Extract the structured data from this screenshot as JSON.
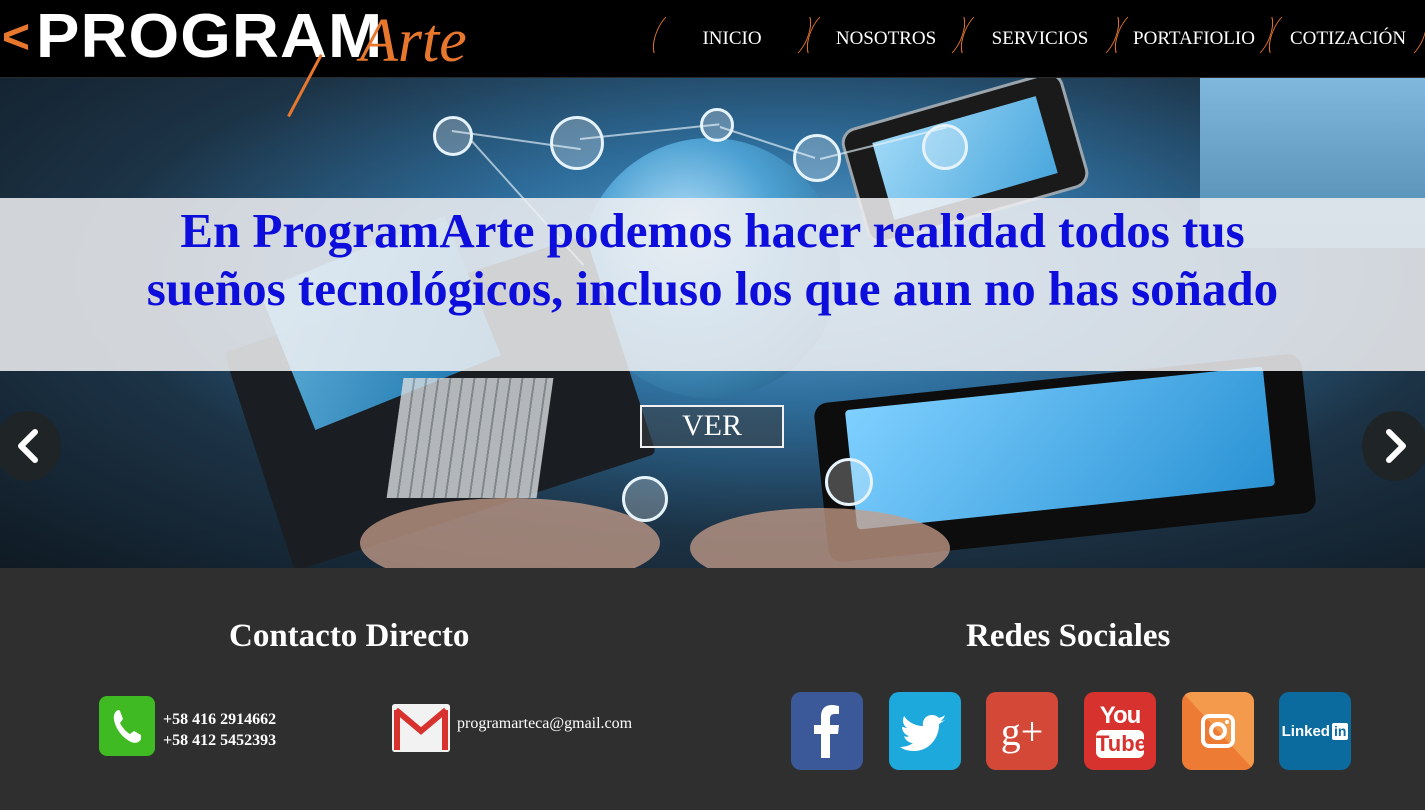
{
  "brand": {
    "prefix": "<",
    "name": "PROGRAM",
    "suffix": "Arte",
    "accent": "#e8772e"
  },
  "nav": {
    "items": [
      {
        "label": "INICIO"
      },
      {
        "label": "NOSOTROS"
      },
      {
        "label": "SERVICIOS"
      },
      {
        "label": "PORTAFIOLIO"
      },
      {
        "label": "COTIZACIÓN"
      }
    ]
  },
  "hero": {
    "headline": "En ProgramArte podemos hacer realidad todos tus sueños tecnológicos, incluso los que aun no has soñado",
    "button_label": "VER",
    "headline_color": "#0d0ddc",
    "prev_icon": "chevron-left-icon",
    "next_icon": "chevron-right-icon"
  },
  "footer": {
    "contact_title": "Contacto Directo",
    "phones": [
      "+58 416 2914662",
      "+58 412 5452393"
    ],
    "email": "programarteca@gmail.com",
    "social_title": "Redes Sociales",
    "social": [
      {
        "name": "facebook-icon",
        "color": "#3b5998"
      },
      {
        "name": "twitter-icon",
        "color": "#1ea9dd"
      },
      {
        "name": "google-plus-icon",
        "label": "g+",
        "color": "#d34836"
      },
      {
        "name": "youtube-icon",
        "label_top": "You",
        "label_bottom": "Tube",
        "color": "#d7322e"
      },
      {
        "name": "instagram-icon",
        "color": "#ee7b34"
      },
      {
        "name": "linkedin-icon",
        "label": "Linked",
        "label_box": "in",
        "color": "#0b6a9e"
      }
    ]
  }
}
